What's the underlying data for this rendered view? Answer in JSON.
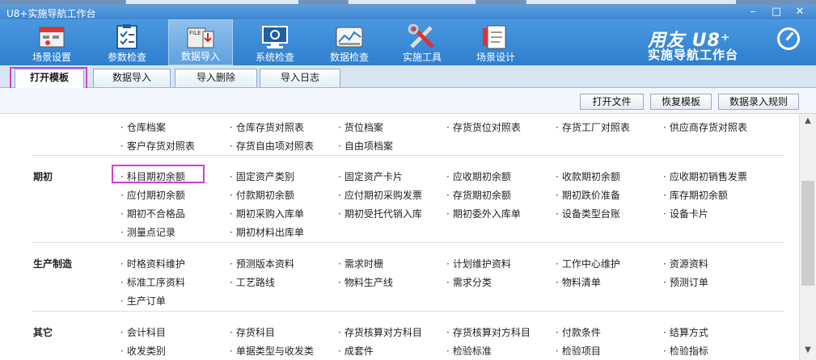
{
  "window": {
    "title": "U8+实施导航工作台",
    "controls": [
      "–",
      "□",
      "✕"
    ]
  },
  "toolbar": {
    "items": [
      {
        "label": "场景设置",
        "icon": "scene-settings-icon"
      },
      {
        "label": "参数检查",
        "icon": "parameter-check-icon"
      },
      {
        "label": "数据导入",
        "icon": "data-import-icon",
        "active": true
      },
      {
        "label": "系统检查",
        "icon": "system-check-icon"
      },
      {
        "label": "数据检查",
        "icon": "data-check-icon"
      },
      {
        "label": "实施工具",
        "icon": "tools-icon"
      },
      {
        "label": "场景设计",
        "icon": "scene-design-icon"
      }
    ],
    "brand_line1": "用友 U8⁺",
    "brand_line2": "实施导航工作台"
  },
  "tabs": [
    {
      "label": "打开模板",
      "active": true
    },
    {
      "label": "数据导入"
    },
    {
      "label": "导入删除"
    },
    {
      "label": "导入日志"
    }
  ],
  "actions": {
    "open_file": "打开文件",
    "restore_template": "恢复模板",
    "entry_rules": "数据录入规则"
  },
  "sections": [
    {
      "category": "",
      "rows": [
        [
          "仓库档案",
          "仓库存货对照表",
          "货位档案",
          "存货货位对照表",
          "存货工厂对照表",
          "供应商存货对照表"
        ],
        [
          "客户存货对照表",
          "存货自由项对照表",
          "自由项档案"
        ]
      ]
    },
    {
      "category": "期初",
      "rows": [
        [
          "科目期初余额",
          "固定资产类别",
          "固定资产卡片",
          "应收期初余额",
          "收款期初余额",
          "应收期初销售发票"
        ],
        [
          "应付期初余额",
          "付款期初余额",
          "应付期初采购发票",
          "存货期初余额",
          "期初跌价准备",
          "库存期初余额"
        ],
        [
          "期初不合格品",
          "期初采购入库单",
          "期初受托代销入库",
          "期初委外入库单",
          "设备类型台账",
          "设备卡片"
        ],
        [
          "测量点记录",
          "期初材料出库单"
        ]
      ]
    },
    {
      "category": "生产制造",
      "rows": [
        [
          "时格资料维护",
          "预测版本资料",
          "需求时栅",
          "计划维护资料",
          "工作中心维护",
          "资源资料"
        ],
        [
          "标准工序资料",
          "工艺路线",
          "物料生产线",
          "需求分类",
          "物料清单",
          "预测订单"
        ],
        [
          "生产订单"
        ]
      ]
    },
    {
      "category": "其它",
      "rows": [
        [
          "会计科目",
          "存货科目",
          "存货核算对方科目",
          "存货核算对方科目",
          "付款条件",
          "结算方式"
        ],
        [
          "收发类别",
          "单据类型与收发类",
          "成套件",
          "检验标准",
          "检验项目",
          "检验指标"
        ]
      ]
    }
  ],
  "scrollbar": {
    "up": "▲",
    "down": "▼"
  }
}
